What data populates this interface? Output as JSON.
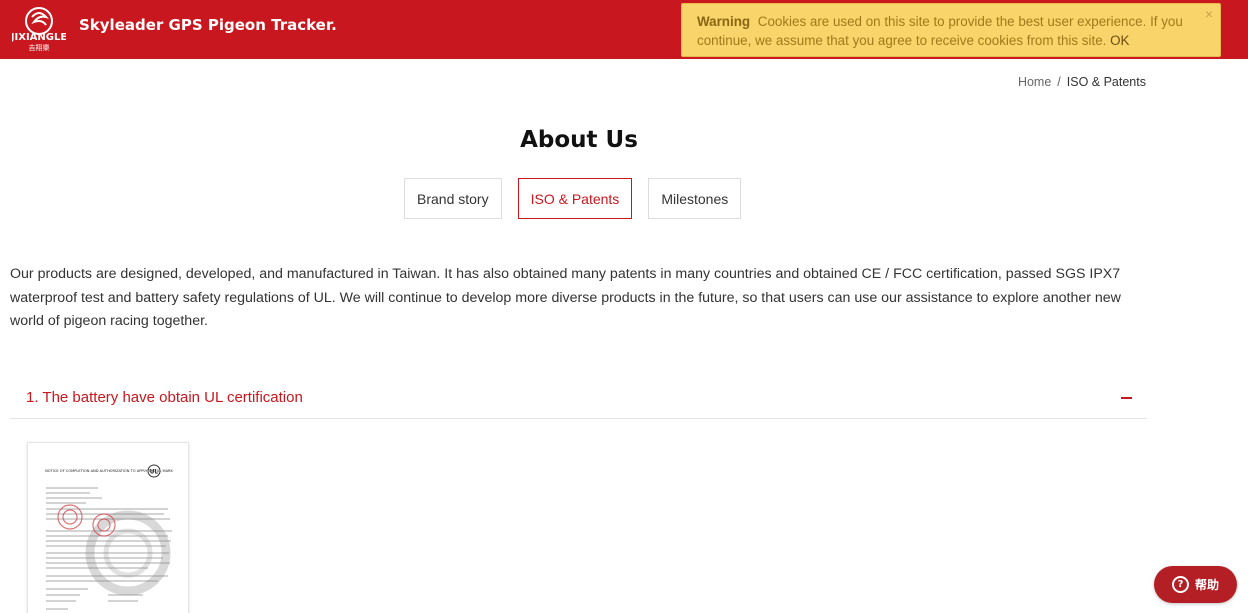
{
  "header": {
    "logo_text": "JIXIANGLE",
    "logo_subtext": "吉翔樂",
    "site_title": "Skyleader GPS Pigeon Tracker."
  },
  "cookie_notice": {
    "label": "Warning",
    "message": "Cookies are used on this site to provide the best user experience. If you continue, we assume that you agree to receive cookies from this site.",
    "ok_label": "OK",
    "close_icon": "close-icon"
  },
  "breadcrumb": {
    "home": "Home",
    "separator": "/",
    "current": "ISO & Patents"
  },
  "page_title": "About Us",
  "tabs": [
    {
      "label": "Brand story",
      "active": false
    },
    {
      "label": "ISO & Patents",
      "active": true
    },
    {
      "label": "Milestones",
      "active": false
    }
  ],
  "intro_text": "Our products are designed, developed, and manufactured in Taiwan. It has also obtained many patents in many countries and obtained CE / FCC certification, passed SGS IPX7 waterproof test and battery safety regulations of UL. We will continue to develop more diverse products in the future, so that users can use our assistance to explore another new world of pigeon racing together.",
  "accordion": {
    "title": "1. The battery have obtain UL certification",
    "toggle_icon": "minus-icon"
  },
  "certificate": {
    "heading": "NOTICE OF COMPLETION AND AUTHORIZATION TO APPLY THE UL MARK",
    "mark": "UL"
  },
  "help_button": {
    "label": "帮助",
    "icon": "question-icon"
  },
  "colors": {
    "brand_red": "#c8171e",
    "cookie_bg": "#f8d46a",
    "help_bg": "#b41f26"
  }
}
